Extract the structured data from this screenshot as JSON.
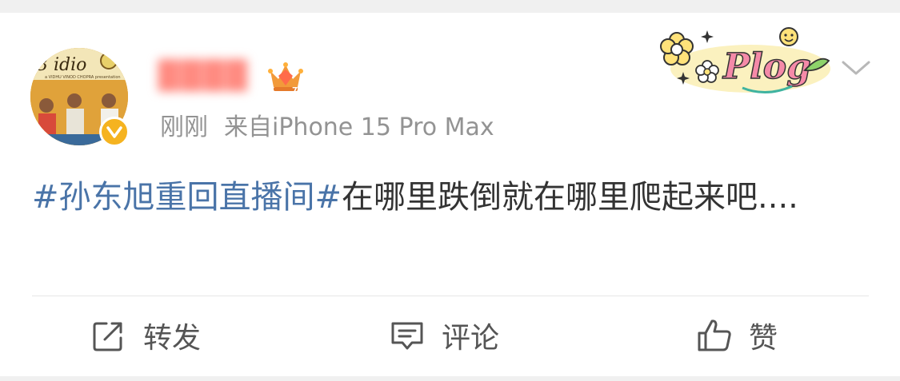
{
  "post": {
    "timestamp": "刚刚",
    "source": "来自iPhone 15 Pro Max",
    "user_name_blurred": "████",
    "content_topic": "#孙东旭重回直播间#",
    "content_text": "在哪里跌倒就在哪里爬起来吧....",
    "sticker_text": "Plog"
  },
  "actions": {
    "repost": "转发",
    "comment": "评论",
    "like": "赞"
  },
  "avatar": {
    "poster_text": "3 idio",
    "caption": "a VIDHU VINOD CHOPRA presentation"
  },
  "colors": {
    "topic": "#4a74a8",
    "meta": "#939393",
    "verified": "#f5b320"
  }
}
